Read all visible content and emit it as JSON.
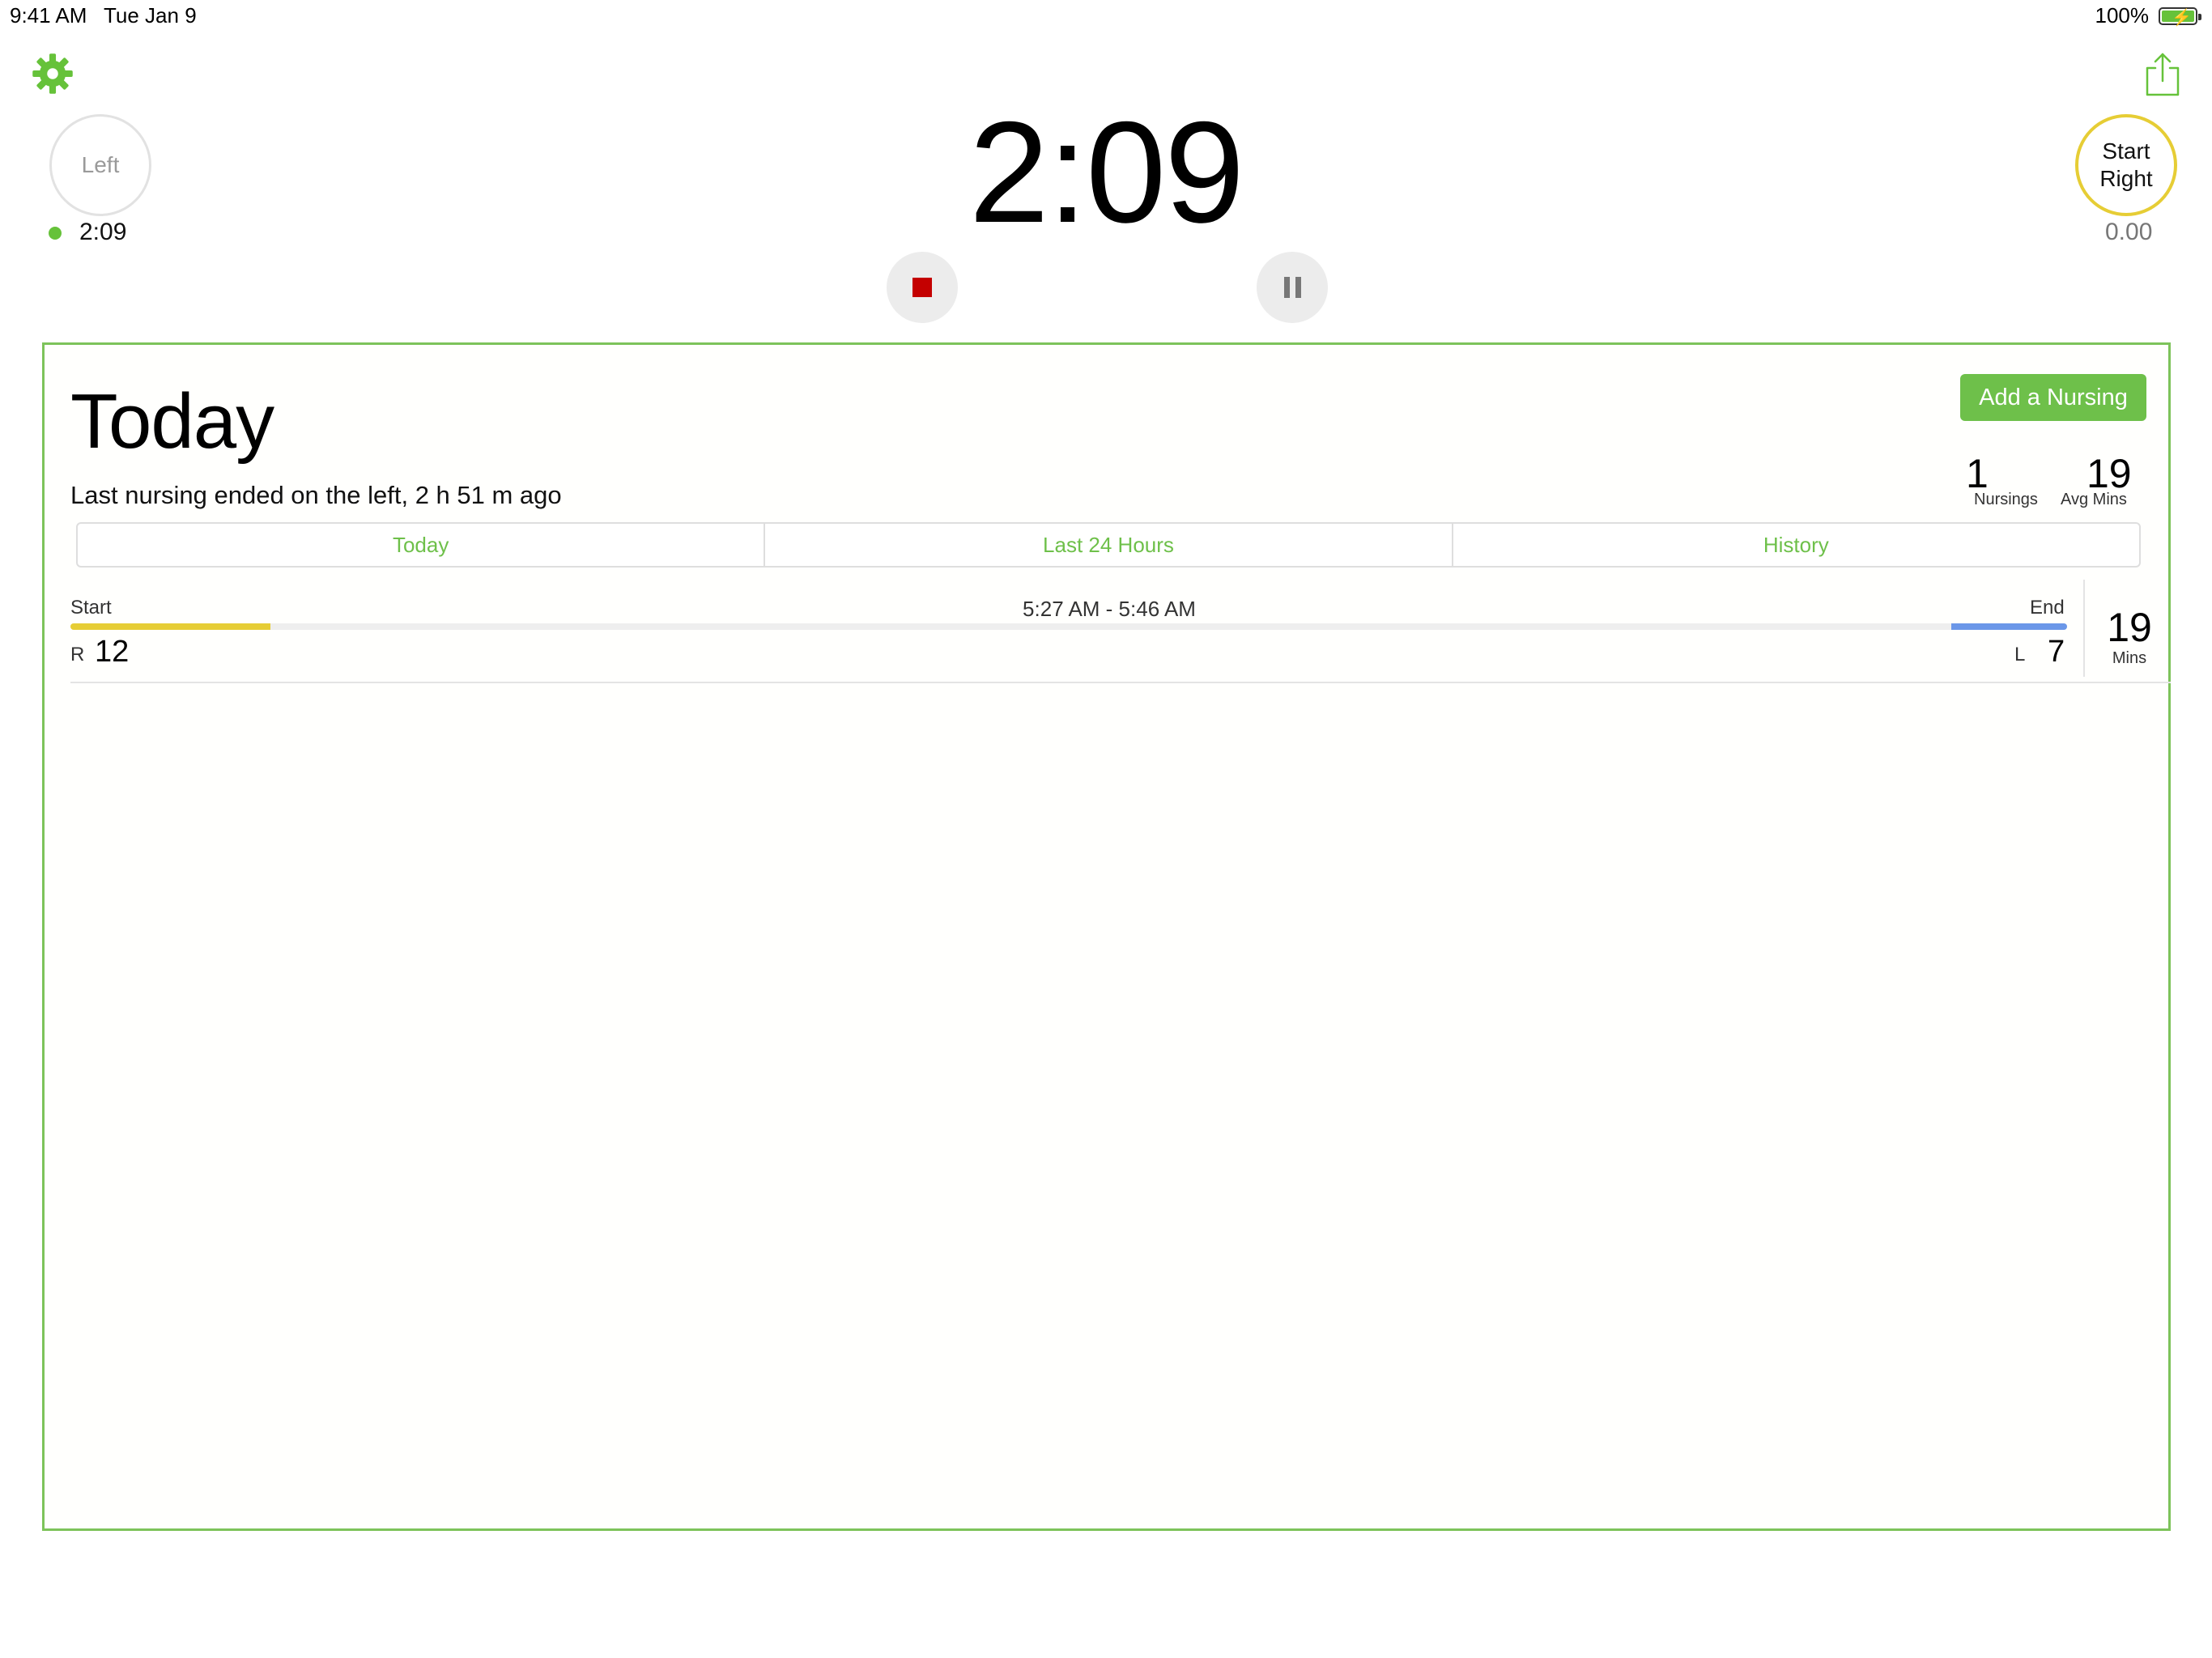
{
  "status_bar": {
    "time": "9:41 AM",
    "date": "Tue Jan 9",
    "battery": "100%"
  },
  "header": {
    "settings_icon": "gear-icon",
    "share_icon": "share-icon",
    "left_button": {
      "label": "Left",
      "time": "2:09"
    },
    "right_button": {
      "label_line1": "Start",
      "label_line2": "Right",
      "time": "0.00"
    },
    "timer": "2:09",
    "stop_icon": "stop-icon",
    "pause_icon": "pause-icon"
  },
  "panel": {
    "title": "Today",
    "subtitle": "Last nursing ended on the left, 2 h 51 m ago",
    "add_button": "Add a Nursing",
    "stats": {
      "nursings_count": "1",
      "nursings_label": "Nursings",
      "avg_mins": "19",
      "avg_label": "Avg Mins"
    },
    "tabs": [
      "Today",
      "Last 24 Hours",
      "History"
    ],
    "sessions": [
      {
        "start_label": "Start",
        "end_label": "End",
        "time_range": "5:27 AM - 5:46 AM",
        "first_side": "R",
        "first_side_mins": "12",
        "second_side": "L",
        "second_side_mins": "7",
        "right_fraction": 0.1,
        "left_fraction": 0.058,
        "total": "19",
        "total_label": "Mins"
      }
    ]
  },
  "colors": {
    "accent_green": "#6ec04a",
    "right_yellow": "#e6cd35",
    "left_blue": "#6b97e8",
    "stop_red": "#c40000"
  }
}
